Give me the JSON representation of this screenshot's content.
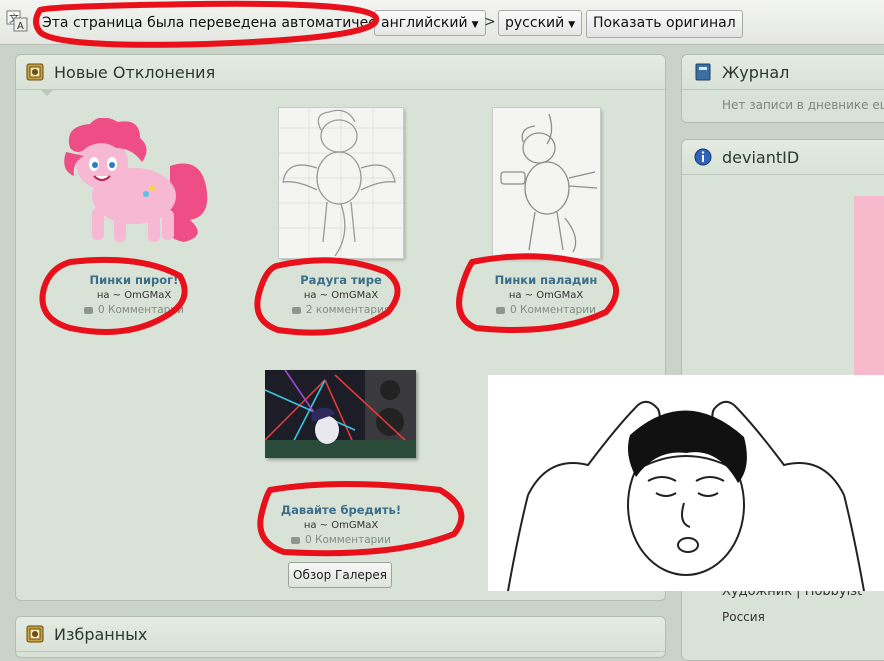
{
  "translate_bar": {
    "message": "Эта страница была переведена автоматически с",
    "from_language": "английский",
    "to_language": "русский",
    "separator": ">",
    "show_original_label": "Показать оригинал"
  },
  "deviations_panel": {
    "title": "Новые Отклонения",
    "items": [
      {
        "title": "Пинки пирог!",
        "author": "на ~ OmGMaX",
        "comments": "0 Комментарии"
      },
      {
        "title": "Радуга тире",
        "author": "на ~ OmGMaX",
        "comments": "2 комментария"
      },
      {
        "title": "Пинки паладин",
        "author": "на ~ OmGMaX",
        "comments": "0 Комментарии"
      },
      {
        "title": "Давайте бредить!",
        "author": "на ~ OmGMaX",
        "comments": "0 Комментарии"
      }
    ],
    "gallery_button": "Обзор Галерея"
  },
  "journal_panel": {
    "title": "Журнал",
    "empty_text": "Нет записи в дневнике ещ"
  },
  "deviantid_panel": {
    "title": "deviantID",
    "roles": "Художник | Hobbyist",
    "country": "Россия"
  },
  "favorites_panel": {
    "title": "Избранных"
  },
  "colors": {
    "page_bg": "#c9d3c8",
    "panel_bg": "#d9e2d7",
    "link": "#3a6e8a",
    "red_annotation": "#e8101a",
    "pink_block": "#f7b9cc"
  }
}
